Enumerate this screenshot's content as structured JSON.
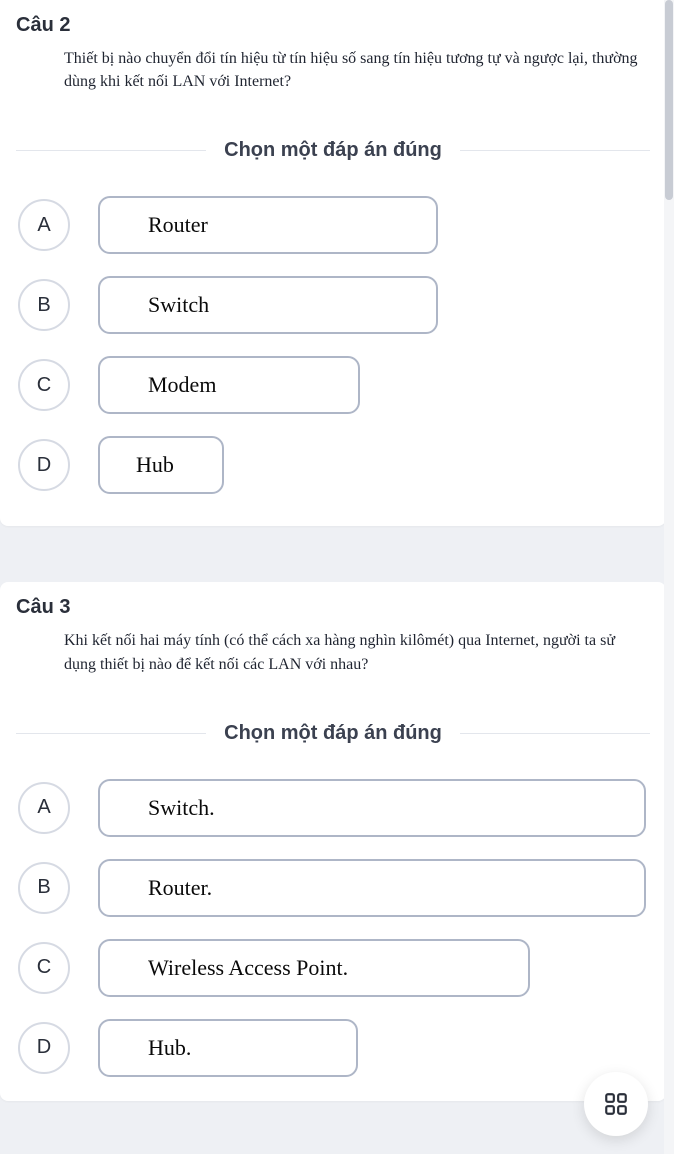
{
  "questions": [
    {
      "title": "Câu 2",
      "body": "Thiết bị nào chuyển đổi tín hiệu từ tín hiệu số sang tín hiệu tương tự và ngược lại, thường dùng khi kết nối LAN với Internet?",
      "instruction": "Chọn một đáp án đúng",
      "options": [
        {
          "letter": "A",
          "label": "Router"
        },
        {
          "letter": "B",
          "label": "Switch"
        },
        {
          "letter": "C",
          "label": "Modem"
        },
        {
          "letter": "D",
          "label": "Hub"
        }
      ]
    },
    {
      "title": "Câu 3",
      "body": "Khi kết nối hai máy tính (có thể cách xa hàng nghìn kilômét) qua Internet, người ta sử dụng thiết bị nào để kết nối các LAN với nhau?",
      "instruction": "Chọn một đáp án đúng",
      "options": [
        {
          "letter": "A",
          "label": "Switch."
        },
        {
          "letter": "B",
          "label": "Router."
        },
        {
          "letter": "C",
          "label": "Wireless Access Point."
        },
        {
          "letter": "D",
          "label": "Hub."
        }
      ]
    }
  ],
  "fab_icon": "grid-icon"
}
